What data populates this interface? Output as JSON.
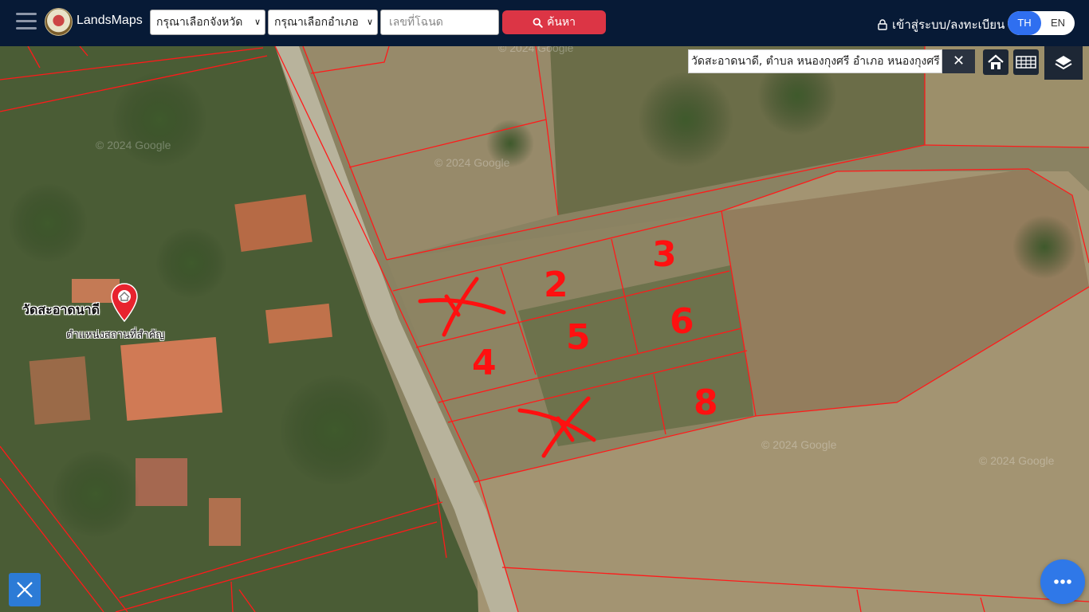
{
  "header": {
    "app_name": "LandsMaps",
    "province_select": "กรุณาเลือกจังหวัด",
    "district_select": "กรุณาเลือกอำเภอ",
    "deed_placeholder": "เลขที่โฉนด",
    "search_label": "ค้นหา",
    "login_label": "เข้าสู่ระบบ/ลงทะเบียน",
    "lang_th": "TH",
    "lang_en": "EN"
  },
  "map": {
    "search_value": "วัดสะอาดนาดี, ตำบล หนองกุงศรี อำเภอ หนองกุงศรี",
    "place_name": "วัดสะอาดนาดี",
    "place_category": "ตำแหน่งสถานที่สำคัญ",
    "watermark": "© 2024 Google",
    "parcel_numbers": [
      "2",
      "3",
      "4",
      "5",
      "6",
      "8"
    ],
    "colors": {
      "parcel_line": "#ff1a1a",
      "annotation": "#ff1010",
      "header_bg": "#071a36",
      "search_button": "#dc3545",
      "lang_active": "#2f6ff0"
    }
  }
}
